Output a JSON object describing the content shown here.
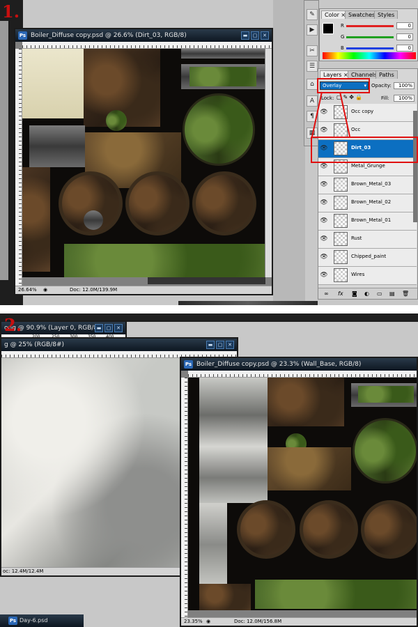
{
  "panel1": {
    "step_label": "1.",
    "window": {
      "title": "Boiler_Diffuse copy.psd @ 26.6% (Dirt_03, RGB/8)",
      "zoom": "26.64%",
      "doc_info": "Doc: 12.0M/139.9M"
    },
    "color_panel": {
      "tabs": [
        "Color",
        "Swatches",
        "Styles"
      ],
      "channels": [
        {
          "label": "R",
          "value": "0",
          "color": "#e02020"
        },
        {
          "label": "G",
          "value": "0",
          "color": "#20a020"
        },
        {
          "label": "B",
          "value": "0",
          "color": "#2040e0"
        }
      ]
    },
    "layers_panel": {
      "tabs": [
        "Layers",
        "Channels",
        "Paths"
      ],
      "blend_mode": "Overlay",
      "opacity_label": "Opacity:",
      "opacity_value": "100%",
      "lock_label": "Lock:",
      "fill_label": "Fill:",
      "fill_value": "100%",
      "layers": [
        {
          "name": "Occ copy",
          "selected": false
        },
        {
          "name": "Occ",
          "selected": false
        },
        {
          "name": "Dirt_03",
          "selected": true
        },
        {
          "name": "Metal_Grunge",
          "selected": false
        },
        {
          "name": "Brown_Metal_03",
          "selected": false
        },
        {
          "name": "Brown_Metal_02",
          "selected": false
        },
        {
          "name": "Brown_Metal_01",
          "selected": false
        },
        {
          "name": "Rust",
          "selected": false
        },
        {
          "name": "Chipped_paint",
          "selected": false
        },
        {
          "name": "Wires",
          "selected": false
        }
      ],
      "footer_icons": [
        "link-icon",
        "fx-icon",
        "mask-icon",
        "adjustment-icon",
        "group-icon",
        "new-layer-icon",
        "trash-icon"
      ]
    },
    "accent_red": "#e01010",
    "selection_blue": "#0c6fc1"
  },
  "panel2": {
    "step_label": "2.",
    "back_window_1": {
      "title": "ong @ 90.9% (Layer 0, RGB/8)",
      "ruler_ticks": [
        "200",
        "250",
        "300",
        "350",
        "400"
      ]
    },
    "back_window_2": {
      "title": "g @ 25% (RGB/8#)",
      "doc_info": "oc: 12.4M/12.4M"
    },
    "front_window": {
      "title": "Boiler_Diffuse copy.psd @ 23.3% (Wall_Base, RGB/8)",
      "zoom": "23.35%",
      "doc_info": "Doc: 12.0M/156.8M"
    },
    "taskbar_item": "Day-6.psd"
  }
}
